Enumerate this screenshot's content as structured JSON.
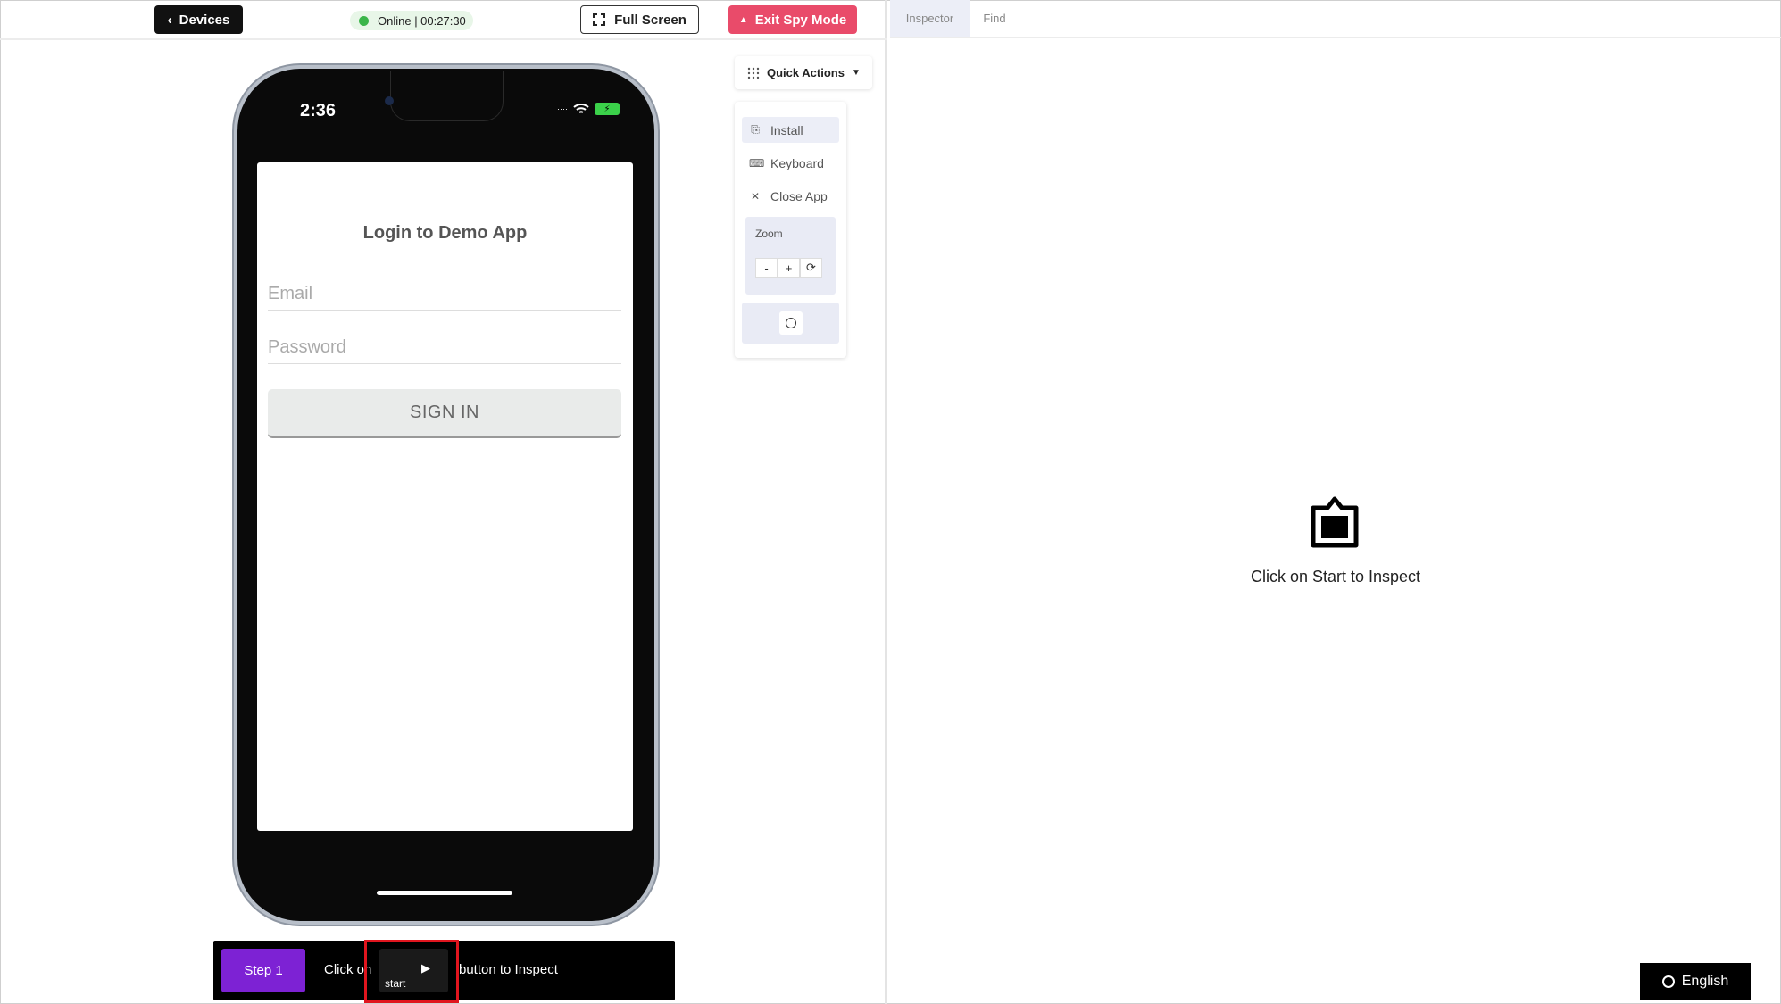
{
  "header": {
    "devices_label": "Devices",
    "status_text": "Online | 00:27:30",
    "fullscreen_label": "Full Screen",
    "exit_spy_label": "Exit Spy Mode"
  },
  "device": {
    "time": "2:36",
    "app": {
      "title": "Login to Demo App",
      "email_placeholder": "Email",
      "password_placeholder": "Password",
      "sign_in_label": "SIGN IN"
    }
  },
  "quick_actions": {
    "label": "Quick Actions",
    "items": [
      {
        "label": "Install",
        "icon": "install-icon"
      },
      {
        "label": "Keyboard",
        "icon": "keyboard-icon"
      },
      {
        "label": "Close App",
        "icon": "close-icon"
      }
    ],
    "zoom": {
      "label": "Zoom",
      "minus": "-",
      "plus": "+",
      "reset": "⟳"
    }
  },
  "step_bar": {
    "step_label": "Step 1",
    "text_before": "Click on",
    "start_label": "start",
    "text_after": "button to Inspect"
  },
  "inspector": {
    "tabs": [
      {
        "label": "Inspector",
        "active": true
      },
      {
        "label": "Find",
        "active": false
      }
    ],
    "empty_message": "Click on Start to Inspect"
  },
  "language": {
    "label": "English"
  },
  "colors": {
    "exit_button": "#e94b6a",
    "step_badge": "#7d22d4",
    "online_dot": "#3bb54a",
    "highlight": "#e0151e"
  }
}
